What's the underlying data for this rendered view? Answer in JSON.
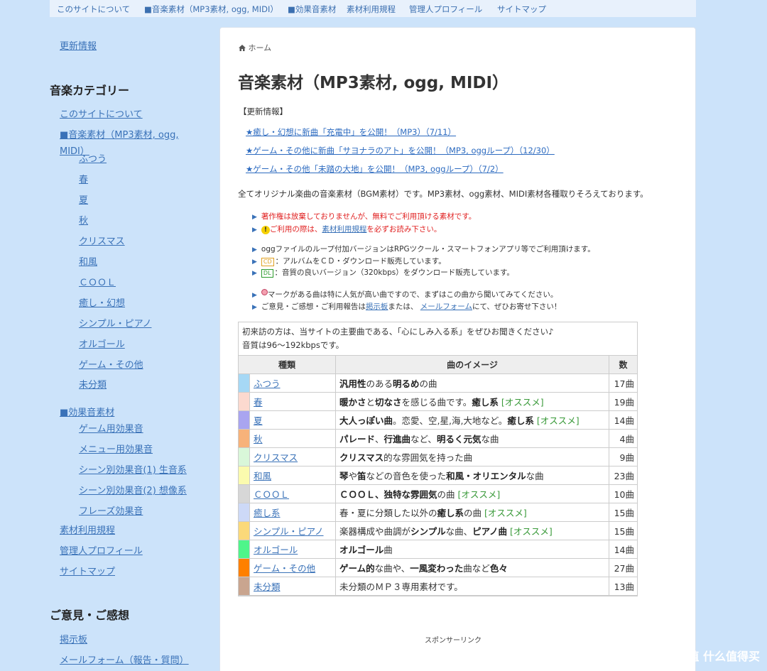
{
  "topnav": [
    {
      "label": "このサイトについて"
    },
    {
      "label": "■音楽素材（MP3素材, ogg, MIDI）"
    },
    {
      "label": "■効果音素材"
    },
    {
      "label": "素材利用規程"
    },
    {
      "label": "管理人プロフィール"
    },
    {
      "label": "サイトマップ"
    }
  ],
  "sidebar": {
    "updates": "更新情報",
    "music_heading": "音楽カテゴリー",
    "about": "このサイトについて",
    "music_top_1": "■音楽素材（MP3素材, ogg,",
    "music_top_2": "MIDI）",
    "music_sub": [
      "ふつう",
      "春",
      "夏",
      "秋",
      "クリスマス",
      "和風",
      "ＣＯＯＬ",
      "癒し・幻想",
      "シンプル・ピアノ",
      "オルゴール",
      "ゲーム・その他",
      "未分類"
    ],
    "sfx_top": "■効果音素材",
    "sfx_sub": [
      "ゲーム用効果音",
      "メニュー用効果音",
      "シーン別効果音(1) 生音系",
      "シーン別効果音(2) 想像系",
      "フレーズ効果音"
    ],
    "rules": "素材利用規程",
    "profile": "管理人プロフィール",
    "sitemap": "サイトマップ",
    "feedback_heading": "ご意見・ご感想",
    "bbs": "掲示板",
    "mailform": "メールフォーム（報告・質問）"
  },
  "main": {
    "breadcrumb": "ホーム",
    "title": "音楽素材（MP3素材, ogg, MIDI）",
    "updates_label": "【更新情報】",
    "news": [
      "★癒し・幻想に新曲「充電中」を公開！（MP3）（7/11）",
      "★ゲーム・その他に新曲「サヨナラのアト」を公開！（MP3, oggループ）（12/30）",
      "★ゲーム・その他「未踏の大地」を公開！（MP3, oggループ）（7/2）"
    ],
    "intro": "全てオリジナル楽曲の音楽素材（BGM素材）です。MP3素材、ogg素材、MIDI素材各種取りそろえております。",
    "notice1": "著作権は放棄しておりませんが、無料でご利用頂ける素材です。",
    "notice2_pre": "ご利用の際は、",
    "notice2_link": "素材利用規程",
    "notice2_post": "を必ずお読み下さい。",
    "info1": "oggファイルのループ付加バージョンはRPGツクール・スマートフォンアプリ等でご利用頂けます。",
    "cd_tag": "CD",
    "info2": "：アルバムをＣＤ・ダウンロード販売しています。",
    "dl_tag": "DL",
    "info3": "：音質の良いバージョン（320kbps）をダウンロード販売しています。",
    "info4": "マークがある曲は特に人気が高い曲ですので、まずはこの曲から聞いてみてください。",
    "info5_pre": "ご意見・ご感想・ご利用報告は",
    "info5_link1": "掲示板",
    "info5_mid": "または、",
    "info5_link2": "メールフォーム",
    "info5_post": "にて、ぜひお寄せ下さい！",
    "table_note1": "初来訪の方は、当サイトの主要曲である、「心にしみ入る系」をぜひお聞きください♪",
    "table_note2": "音質は96～192kbpsです。",
    "table_headers": [
      "種類",
      "曲のイメージ",
      "数"
    ],
    "sponsor": "スポンサーリンク"
  },
  "table_rows": [
    {
      "color": "#a6d8f5",
      "name": "ふつう",
      "desc_html": "<b>汎用性</b>のある<b>明るめ</b>の曲",
      "count": "17曲"
    },
    {
      "color": "#fcd9cf",
      "name": "春",
      "desc_html": "<b>暖かさ</b>と<b>切なさ</b>を感じる曲です。<b>癒し系</b> <span class='rec'>[オススメ]</span>",
      "count": "19曲"
    },
    {
      "color": "#a9a5f0",
      "name": "夏",
      "desc_html": "<b>大人っぽい曲</b>。恋愛、空,星,海,大地など。<b>癒し系</b> <span class='rec'>[オススメ]</span>",
      "count": "14曲"
    },
    {
      "color": "#f7b27a",
      "name": "秋",
      "desc_html": "<b>パレード</b>、<b>行進曲</b>など、<b>明るく元気</b>な曲",
      "count": "4曲"
    },
    {
      "color": "#d9f7d9",
      "name": "クリスマス",
      "desc_html": "<b>クリスマス</b>的な雰囲気を持った曲",
      "count": "9曲"
    },
    {
      "color": "#fbfbae",
      "name": "和風",
      "desc_html": "<b>琴</b>や<b>笛</b>などの音色を使った<b>和風・オリエンタル</b>な曲",
      "count": "23曲"
    },
    {
      "color": "#d7d7d7",
      "name": "ＣＯＯＬ",
      "desc_html": "<b>ＣＯＯＬ、独特な雰囲気</b>の曲 <span class='rec'>[オススメ]</span>",
      "count": "10曲"
    },
    {
      "color": "#cdd9f7",
      "name": "癒し系",
      "desc_html": "春・夏に分類した以外の<b>癒し系</b>の曲 <span class='rec'>[オススメ]</span>",
      "count": "15曲"
    },
    {
      "color": "#fbd97a",
      "name": "シンプル・ピアノ",
      "desc_html": "楽器構成や曲調が<b>シンプル</b>な曲、<b>ピアノ曲</b> <span class='rec'>[オススメ]</span>",
      "count": "15曲"
    },
    {
      "color": "#4ff58a",
      "name": "オルゴール",
      "desc_html": "<b>オルゴール</b>曲",
      "count": "14曲"
    },
    {
      "color": "#ff8000",
      "name": "ゲーム・その他",
      "desc_html": "<b>ゲーム的</b>な曲や、<b>一風変わった</b>曲など<b>色々</b>",
      "count": "27曲"
    },
    {
      "color": "#c9a58f",
      "name": "未分類",
      "desc_html": "未分類のＭＰ３専用素材です。",
      "count": "13曲"
    }
  ],
  "watermark": "值 什么值得买"
}
